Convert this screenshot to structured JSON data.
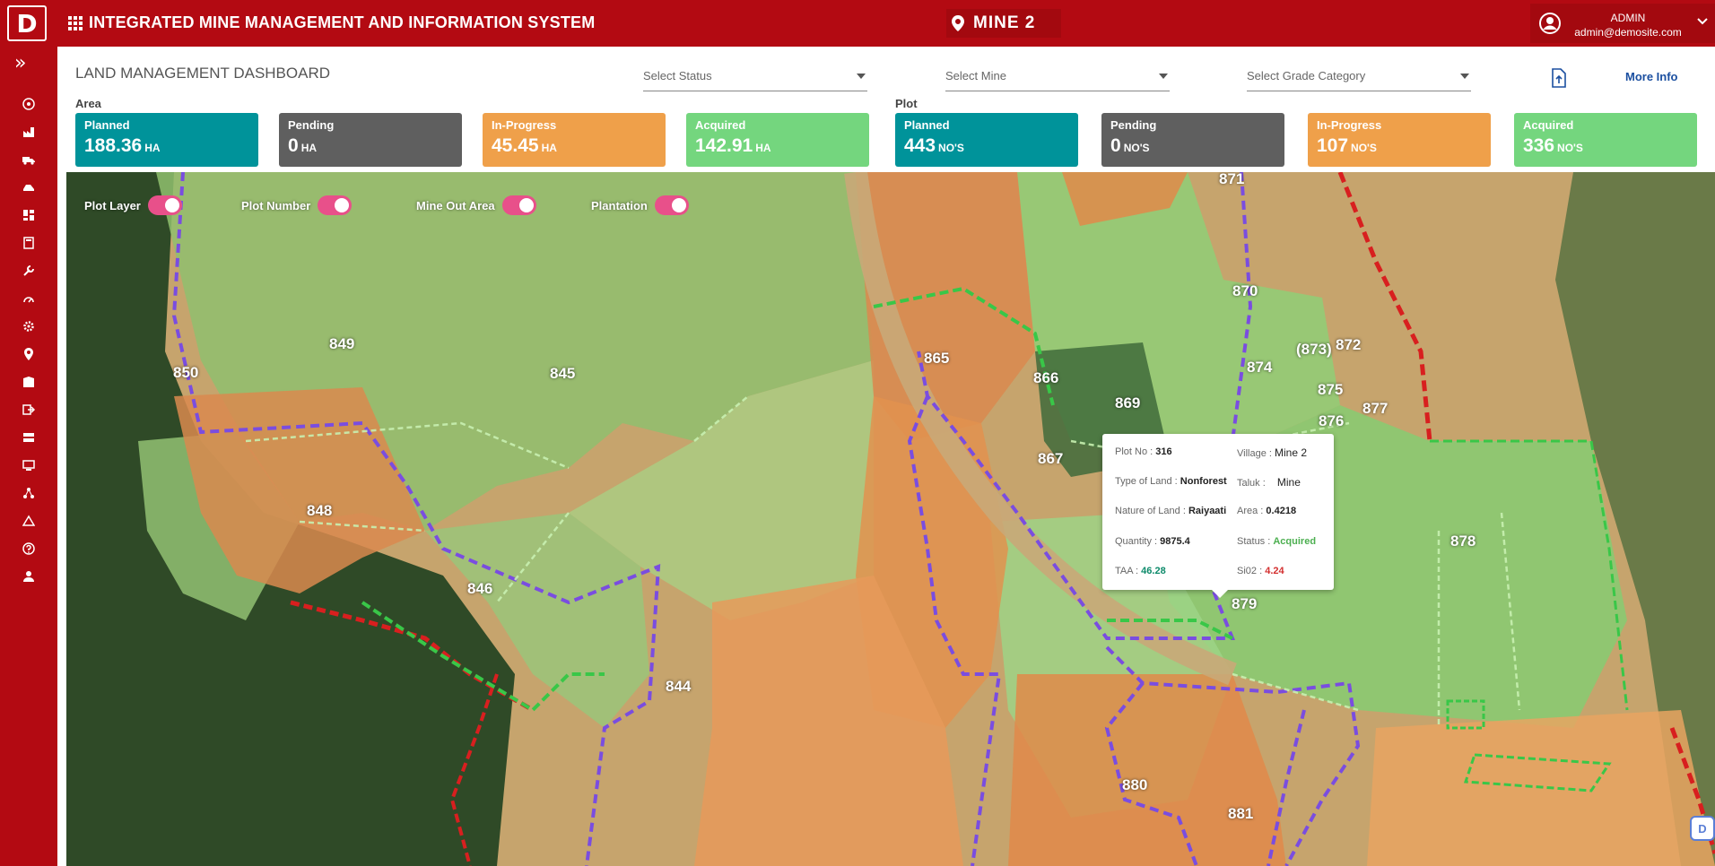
{
  "header": {
    "app_title": "INTEGRATED MINE MANAGEMENT AND INFORMATION SYSTEM",
    "logo_text": "D",
    "current_mine": "MINE 2",
    "user": {
      "name": "ADMIN",
      "email": "admin@demosite.com"
    }
  },
  "sidebar": {
    "expand_glyph": "»",
    "items": [
      "radar-icon",
      "factory-icon",
      "truck-icon",
      "vehicle-icon",
      "dashboard-icon",
      "calculator-icon",
      "tools-icon",
      "gauge-icon",
      "settings-icon",
      "location-icon",
      "building-icon",
      "export-icon",
      "server-icon",
      "monitor-icon",
      "network-icon",
      "warning-icon",
      "help-icon",
      "user-icon"
    ]
  },
  "dashboard": {
    "title": "LAND MANAGEMENT DASHBOARD",
    "filters": {
      "status_placeholder": "Select Status",
      "mine_placeholder": "Select Mine",
      "grade_placeholder": "Select Grade Category"
    },
    "more_info": "More Info"
  },
  "area": {
    "label": "Area",
    "cards": [
      {
        "label": "Planned",
        "value": "188.36",
        "unit": "HA",
        "color": "#00939a"
      },
      {
        "label": "Pending",
        "value": "0",
        "unit": "HA",
        "color": "#5f5f5f"
      },
      {
        "label": "In-Progress",
        "value": "45.45",
        "unit": "HA",
        "color": "#efa04a"
      },
      {
        "label": "Acquired",
        "value": "142.91",
        "unit": "HA",
        "color": "#74d67e"
      }
    ]
  },
  "plot": {
    "label": "Plot",
    "cards": [
      {
        "label": "Planned",
        "value": "443",
        "unit": "NO'S",
        "color": "#00939a"
      },
      {
        "label": "Pending",
        "value": "0",
        "unit": "NO'S",
        "color": "#5f5f5f"
      },
      {
        "label": "In-Progress",
        "value": "107",
        "unit": "NO'S",
        "color": "#efa04a"
      },
      {
        "label": "Acquired",
        "value": "336",
        "unit": "NO'S",
        "color": "#74d67e"
      }
    ]
  },
  "map": {
    "layers": [
      {
        "label": "Plot Layer",
        "on": true
      },
      {
        "label": "Plot Number",
        "on": true
      },
      {
        "label": "Mine Out Area",
        "on": true
      },
      {
        "label": "Plantation",
        "on": true
      }
    ],
    "plot_numbers": [
      "871",
      "870",
      "849",
      "845",
      "850",
      "865",
      "866",
      "869",
      "874",
      "(873)",
      "872",
      "875",
      "876",
      "877",
      "848",
      "867",
      "846",
      "878",
      "879",
      "844",
      "880",
      "881"
    ],
    "popup": {
      "plot_no_label": "Plot No :",
      "plot_no": "316",
      "village_label": "Village :",
      "village": "Mine 2",
      "type_label": "Type of Land :",
      "type": "Nonforest",
      "taluk_label": "Taluk :",
      "taluk": "Mine",
      "nature_label": "Nature of Land :",
      "nature": "Raiyaati",
      "area_label": "Area :",
      "area": "0.4218",
      "quantity_label": "Quantity :",
      "quantity": "9875.4",
      "status_label": "Status :",
      "status": "Acquired",
      "taa_label": "TAA :",
      "taa": "46.28",
      "sio2_label": "Si02 :",
      "sio2": "4.24"
    }
  },
  "help_fab": "D"
}
